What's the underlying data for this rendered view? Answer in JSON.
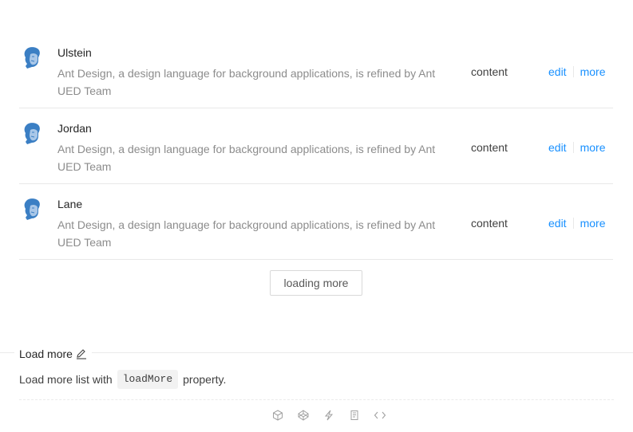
{
  "list": {
    "items": [
      {
        "name": "Ulstein",
        "description": "Ant Design, a design language for background applications, is refined by Ant UED Team",
        "content": "content",
        "edit": "edit",
        "more": "more"
      },
      {
        "name": "Jordan",
        "description": "Ant Design, a design language for background applications, is refined by Ant UED Team",
        "content": "content",
        "edit": "edit",
        "more": "more"
      },
      {
        "name": "Lane",
        "description": "Ant Design, a design language for background applications, is refined by Ant UED Team",
        "content": "content",
        "edit": "edit",
        "more": "more"
      }
    ],
    "load_button": "loading more"
  },
  "meta": {
    "title": "Load more",
    "desc_before": "Load more list with",
    "code": "loadMore",
    "desc_after": "property."
  },
  "code_actions": [
    "codesandbox-icon",
    "codepen-icon",
    "stackblitz-icon",
    "copy-icon",
    "expand-code-icon"
  ],
  "colors": {
    "link": "#1890ff",
    "border": "#e8e8e8",
    "avatar": "#3b7fc4"
  }
}
